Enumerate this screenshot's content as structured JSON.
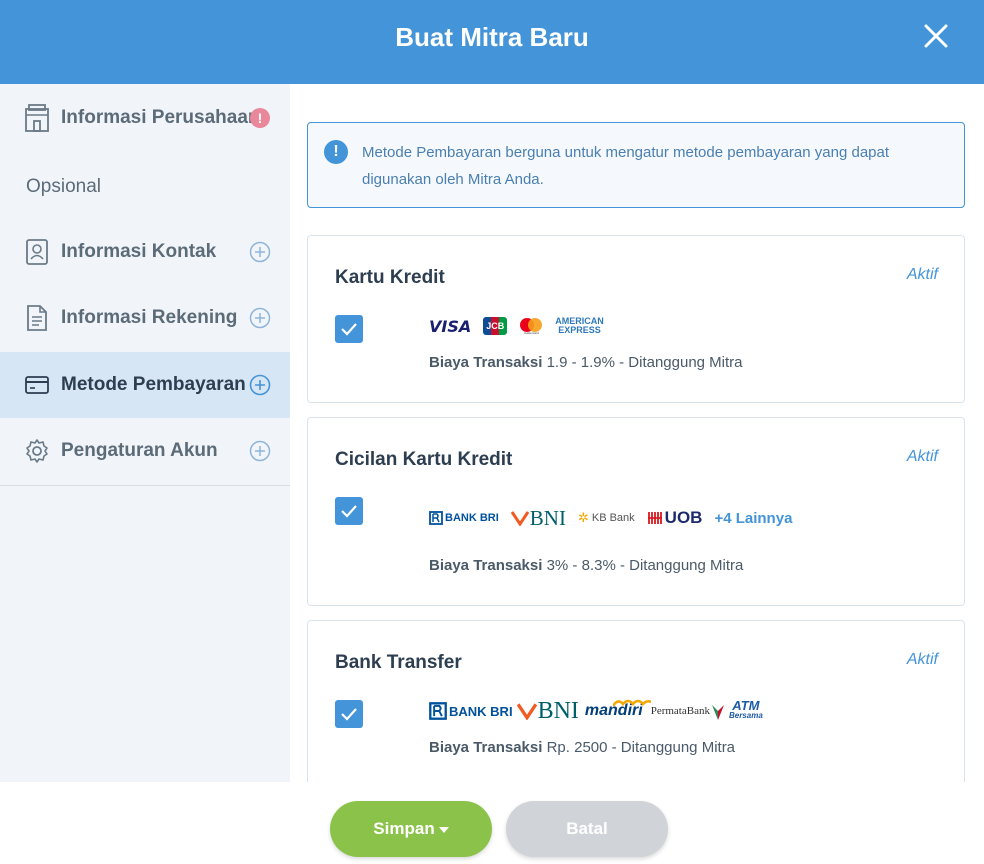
{
  "header": {
    "title": "Buat Mitra Baru"
  },
  "sidebar": {
    "items": [
      {
        "label": "Informasi Perusahaan"
      },
      {
        "label": "Informasi Kontak"
      },
      {
        "label": "Informasi Rekening"
      },
      {
        "label": "Metode Pembayaran"
      },
      {
        "label": "Pengaturan Akun"
      }
    ],
    "section_label": "Opsional",
    "warning_badge": "!"
  },
  "info": {
    "icon": "!",
    "text": "Metode Pembayaran berguna untuk mengatur metode pembayaran yang dapat digunakan oleh Mitra Anda."
  },
  "cards": [
    {
      "title": "Kartu Kredit",
      "status": "Aktif",
      "checked": true,
      "logos": [
        "VISA",
        "JCB",
        "mastercard",
        "AMERICAN",
        "EXPRESS"
      ],
      "fee_label": "Biaya Transaksi",
      "fee_value": " 1.9 - 1.9% -  Ditanggung Mitra"
    },
    {
      "title": "Cicilan Kartu Kredit",
      "status": "Aktif",
      "checked": true,
      "logos": [
        "BANK BRI",
        "BNI",
        "KB Bank",
        "UOB"
      ],
      "more": "+4 Lainnya",
      "fee_label": "Biaya Transaksi",
      "fee_value": " 3% - 8.3% -  Ditanggung Mitra"
    },
    {
      "title": "Bank Transfer",
      "status": "Aktif",
      "checked": true,
      "logos": [
        "BANK BRI",
        "BNI",
        "mandiri",
        "PermataBank",
        "ATM",
        "Bersama"
      ],
      "fee_label": "Biaya Transaksi",
      "fee_value": " Rp. 2500 -  Ditanggung Mitra"
    }
  ],
  "footer": {
    "save_label": "Simpan",
    "cancel_label": "Batal"
  },
  "colors": {
    "primary": "#4394d8",
    "save": "#8bc34a",
    "cancel": "#d0d4d9",
    "active_nav": "#d6e6f5"
  }
}
